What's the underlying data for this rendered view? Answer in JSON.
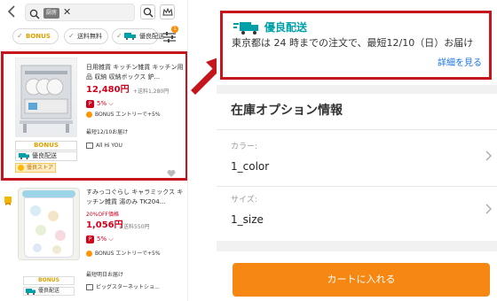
{
  "search": {
    "chip_text": "厨房",
    "clear_glyph": "✕"
  },
  "filters": [
    {
      "label": "BONUS"
    },
    {
      "label": "送料無料"
    },
    {
      "label": "優良配送"
    }
  ],
  "filter_badge": "1",
  "products": [
    {
      "title": "日用雑貨 キッチン雑貨 キッチン用品 収納 収納ボックス 鈩...",
      "price": "12,480円",
      "shipping": "+送料1,280円",
      "points": "5%",
      "bonus_entry": "BONUS エントリーで+5%",
      "delivery": "最短12/10お届け",
      "shop": "All Hi YOU",
      "tags": {
        "bonus": "BONUS",
        "yuryo": "優良配送",
        "store": "優良ストア"
      }
    },
    {
      "title": "すみっコぐらし キャラミックス キッチン雑貨 湯のみ TK204...",
      "sale": "20%OFF価格",
      "price": "1,056円",
      "shipping": "+送料550円",
      "points": "5%",
      "bonus_entry": "BONUS エントリーで+5%",
      "delivery": "最短明日お届け",
      "shop": "ビッグスターネットショ...",
      "tags": {
        "bonus": "BONUS",
        "yuryo": "優良配送"
      }
    }
  ],
  "shipping_panel": {
    "label": "優良配送",
    "message": "東京都は 24 時までの注文で、最短12/10（日）お届け",
    "details_link": "詳細を見る"
  },
  "stock_options": {
    "title": "在庫オプション情報",
    "options": [
      {
        "label": "カラー:",
        "value": "1_color"
      },
      {
        "label": "サイズ:",
        "value": "1_size"
      }
    ]
  },
  "cart_button": "カートに入れる",
  "colors": {
    "highlight": "#c4161c",
    "price_red": "#d0011b",
    "yuryo_teal": "#00a0a8",
    "cart_orange": "#f68712",
    "link_blue": "#1a73e8"
  }
}
